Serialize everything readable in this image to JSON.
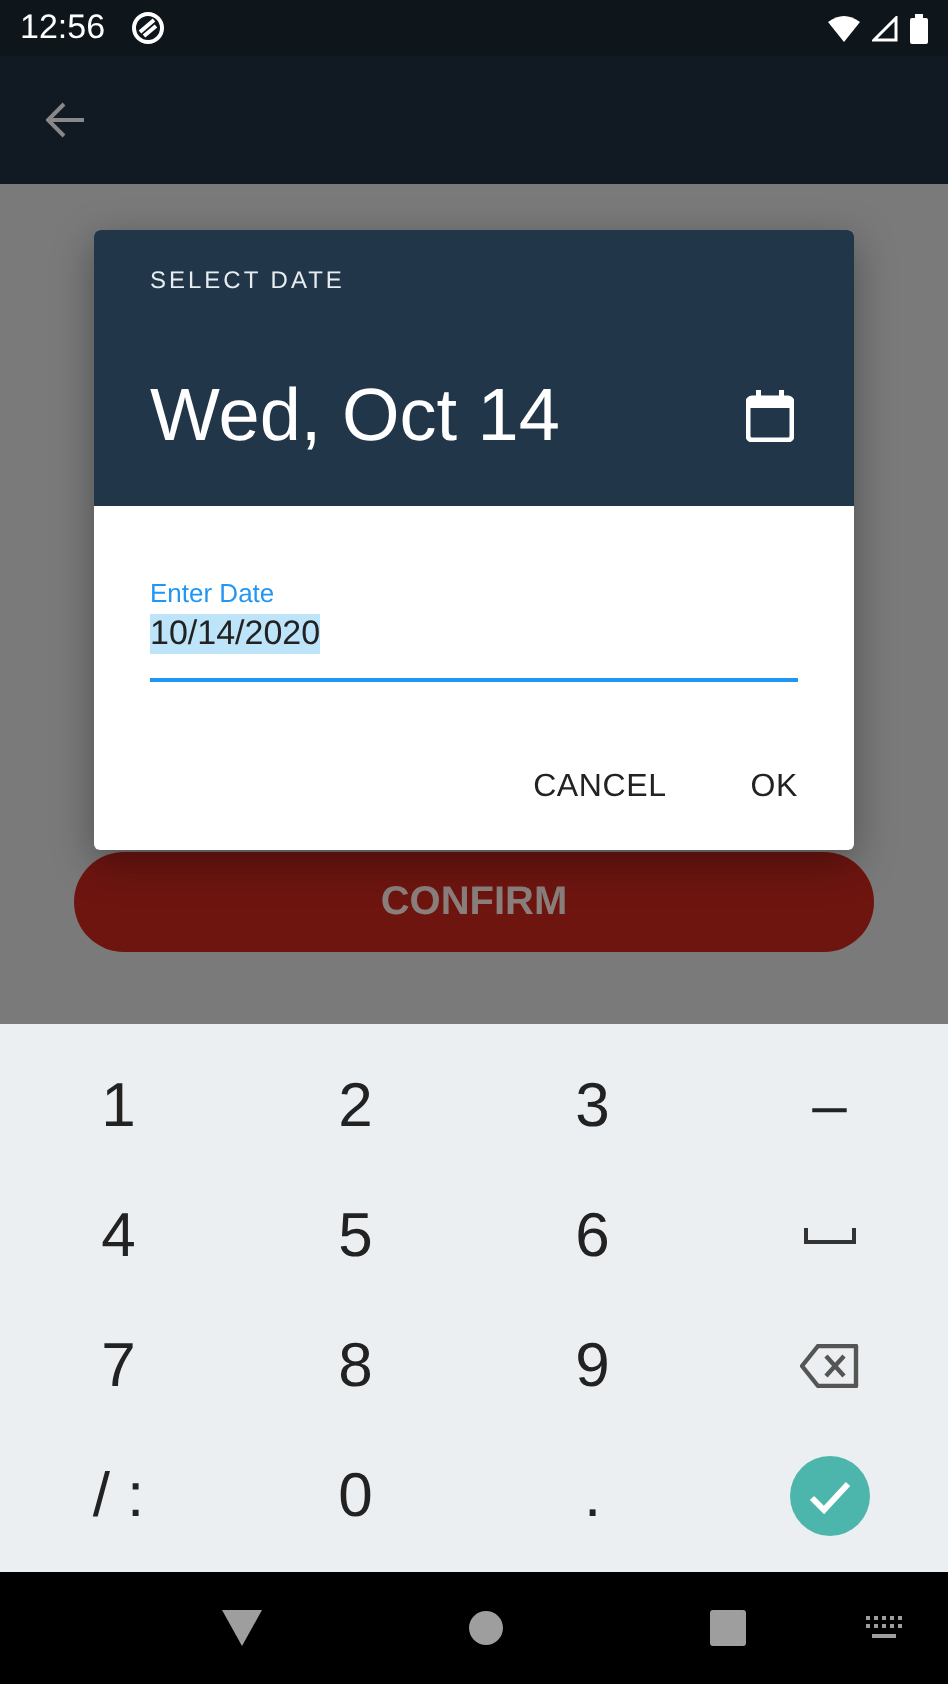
{
  "status_bar": {
    "time": "12:56"
  },
  "page": {
    "confirm_button": "CONFIRM"
  },
  "dialog": {
    "title": "SELECT DATE",
    "date": "Wed, Oct 14",
    "field": {
      "label": "Enter Date",
      "value": "10/14/2020",
      "highlighted": true
    },
    "actions": [
      "CANCEL",
      "OK"
    ]
  },
  "keyboard": {
    "keys": [
      {
        "kind": "text",
        "label": "1"
      },
      {
        "kind": "text",
        "label": "2"
      },
      {
        "kind": "text",
        "label": "3"
      },
      {
        "kind": "text",
        "label": "–"
      },
      {
        "kind": "text",
        "label": "4"
      },
      {
        "kind": "text",
        "label": "5"
      },
      {
        "kind": "text",
        "label": "6"
      },
      {
        "kind": "space"
      },
      {
        "kind": "text",
        "label": "7"
      },
      {
        "kind": "text",
        "label": "8"
      },
      {
        "kind": "text",
        "label": "9"
      },
      {
        "kind": "backspace"
      },
      {
        "kind": "text",
        "label": "/ :"
      },
      {
        "kind": "text",
        "label": "0"
      },
      {
        "kind": "text",
        "label": "."
      },
      {
        "kind": "done"
      }
    ]
  }
}
